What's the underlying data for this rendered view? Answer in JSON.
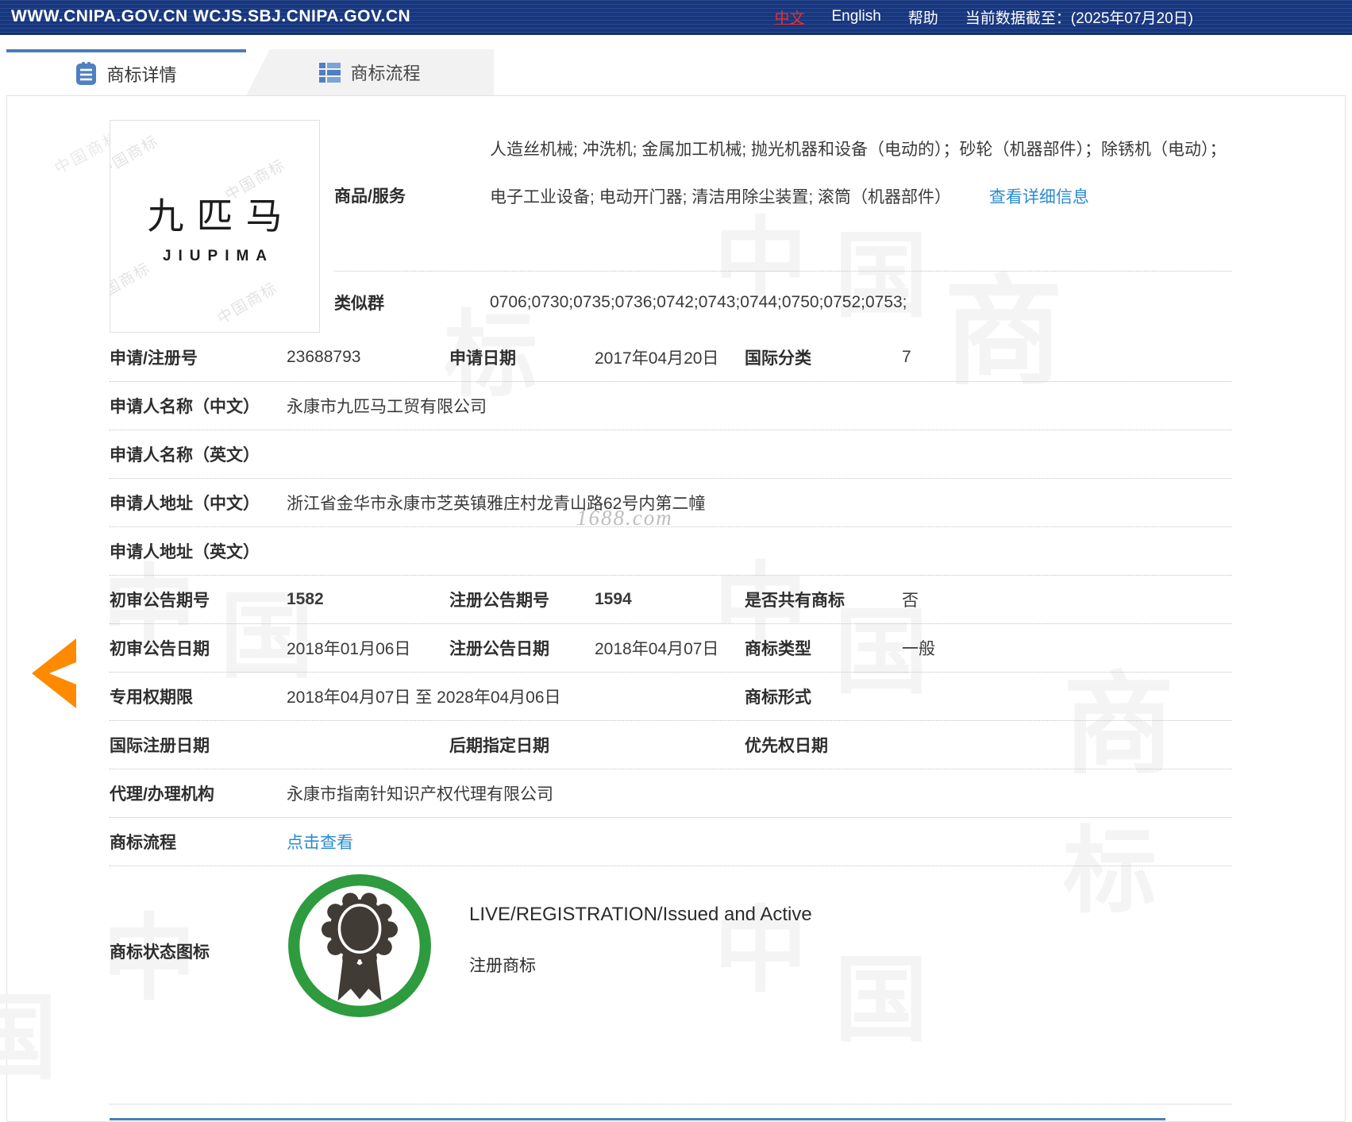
{
  "header": {
    "urls": "WWW.CNIPA.GOV.CN WCJS.SBJ.CNIPA.GOV.CN",
    "lang_zh": "中文",
    "lang_en": "English",
    "help": "帮助",
    "cutoff": "当前数据截至：(2025年07月20日)"
  },
  "tabs": {
    "detail": "商标详情",
    "process": "商标流程"
  },
  "mark_image": {
    "zh": "九匹马",
    "en": "JIUPIMA",
    "watermark": "中国商标",
    "site_watermark": "1688.com"
  },
  "goods": {
    "label": "商品/服务",
    "value": "人造丝机械; 冲洗机; 金属加工机械; 抛光机器和设备（电动的）；砂轮（机器部件）；除锈机（电动）；电子工业设备; 电动开门器; 清洁用除尘装置; 滚筒（机器部件）",
    "more_link": "查看详细信息"
  },
  "similar_group": {
    "label": "类似群",
    "value": "0706;0730;0735;0736;0742;0743;0744;0750;0752;0753;"
  },
  "fields": {
    "reg_no": {
      "label": "申请/注册号",
      "value": "23688793"
    },
    "app_date": {
      "label": "申请日期",
      "value": "2017年04月20日"
    },
    "intl_class": {
      "label": "国际分类",
      "value": "7"
    },
    "applicant_zh": {
      "label": "申请人名称（中文）",
      "value": "永康市九匹马工贸有限公司"
    },
    "applicant_en": {
      "label": "申请人名称（英文）",
      "value": ""
    },
    "address_zh": {
      "label": "申请人地址（中文）",
      "value": "浙江省金华市永康市芝英镇雅庄村龙青山路62号内第二幢"
    },
    "address_en": {
      "label": "申请人地址（英文）",
      "value": ""
    },
    "first_pub_no": {
      "label": "初审公告期号",
      "value": "1582"
    },
    "reg_pub_no": {
      "label": "注册公告期号",
      "value": "1594"
    },
    "is_shared": {
      "label": "是否共有商标",
      "value": "否"
    },
    "first_pub_date": {
      "label": "初审公告日期",
      "value": "2018年01月06日"
    },
    "reg_pub_date": {
      "label": "注册公告日期",
      "value": "2018年04月07日"
    },
    "mark_type": {
      "label": "商标类型",
      "value": "一般"
    },
    "term": {
      "label": "专用权期限",
      "value": "2018年04月07日 至 2028年04月06日"
    },
    "mark_form": {
      "label": "商标形式",
      "value": ""
    },
    "intl_reg_date": {
      "label": "国际注册日期",
      "value": ""
    },
    "later_desig": {
      "label": "后期指定日期",
      "value": ""
    },
    "priority_date": {
      "label": "优先权日期",
      "value": ""
    },
    "agency": {
      "label": "代理/办理机构",
      "value": "永康市指南针知识产权代理有限公司"
    },
    "process": {
      "label": "商标流程",
      "link": "点击查看"
    },
    "status": {
      "label": "商标状态图标",
      "line1": "LIVE/REGISTRATION/Issued and Active",
      "line2": "注册商标"
    }
  },
  "watermarks": {
    "g0": "中",
    "g1": "国",
    "g2": "商",
    "g3": "标",
    "g4": "中",
    "g5": "国",
    "g6": "中",
    "g7": "国",
    "g8": "商",
    "g9": "中",
    "g10": "中",
    "g11": "国",
    "g12": "标",
    "g13": "国"
  },
  "colors": {
    "header_bg": "#16367F",
    "tab_accent": "#4A7EBB",
    "link_blue": "#2A8BD2",
    "arrow_orange": "#FF8A00",
    "badge_green": "#2E9B3E",
    "badge_dark": "#413B36",
    "lang_red": "#E8312F"
  }
}
